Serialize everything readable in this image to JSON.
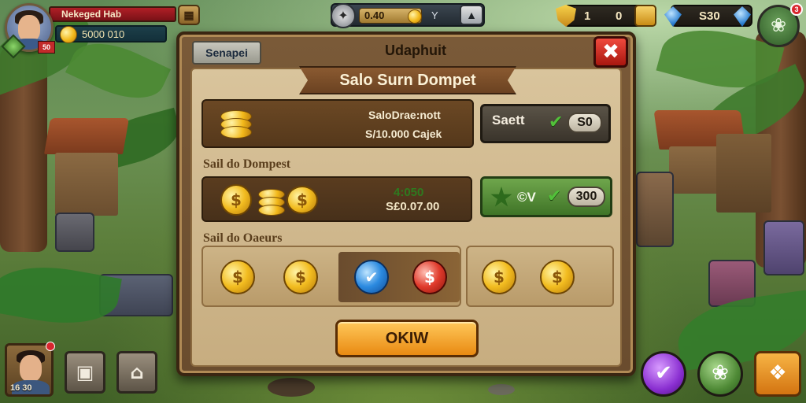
{
  "player": {
    "name": "Nekeged Hab",
    "coins": "5000 010",
    "rank_flag": "50"
  },
  "hud": {
    "energy_value": "0.40",
    "energy_y": "Y",
    "shield_count": "1",
    "gold_count": "0",
    "gem_count": "S30",
    "settings_notif": "3"
  },
  "dialog": {
    "tab_label": "Senapei",
    "header": "Udaphuit",
    "ribbon_title": "Salo Surn Dompet",
    "row1": {
      "line1": "SaloDrae:nott",
      "line2": "S/10.000 Cajek",
      "button_label": "Saett",
      "price": "S0"
    },
    "section1_label": "Sail do Dompest",
    "row2": {
      "value1": "4:050",
      "value2": "S£0.07.00",
      "button_label": "©V",
      "price": "300"
    },
    "section2_label": "Sail do Oaeurs",
    "ok_label": "OKIW"
  },
  "bottom_bar": {
    "portrait_label": "16 30"
  },
  "icons": {
    "energy": "compass-icon",
    "plus": "plus-icon",
    "close": "close-icon",
    "settings": "leaf-icon",
    "check": "check-icon"
  },
  "colors": {
    "close_red": "#e03b2c",
    "ok_orange": "#e98a12",
    "sell_green": "#4f8a30",
    "coin_gold": "#f2bc20"
  }
}
